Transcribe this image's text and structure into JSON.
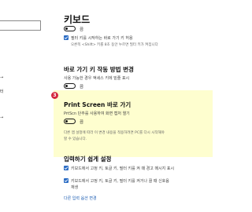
{
  "sidebar": {
    "search_value": "",
    "frag_top": "˄",
    "item_a": "→",
    "item_b": "터",
    "item_c": "→"
  },
  "sticky_keys": {
    "title": "키보드",
    "toggle_state": "끔",
    "checkbox_label": "필터 키를 시작하는 바로 가기 키 허용",
    "description": "오른쪽 <Shift> 키를 8초 동안 누르면 필터 키가 켜집니다"
  },
  "underline_keys": {
    "title": "바로 가기 키 작동 방법 변경",
    "description": "사용 가능한 경우 액세스 키에 밑줄 표시",
    "toggle_state": "끔"
  },
  "print_screen": {
    "badge": "3",
    "title": "Print Screen 바로 가기",
    "description": "PrtScn 단추를 사용하여 화면 캡처 열기",
    "toggle_state": "끔",
    "note_line1": "다른 앱 설정에 따라 이 변경 내용을 적용하려면 PC를 다시 시작해야",
    "note_line2": "할 수 있습니다."
  },
  "typing": {
    "title": "입력하기 쉽게 설정",
    "item1_line1": "키보드에서 고정 키, 토글 키, 필터 키를 켜 때 경고 메시지 표시",
    "item1_line2": "",
    "item2_line1": "키보드에서 고정 키, 토글 키, 필터 키를 켜거나 끌 때 신호음",
    "item2_line2": "재생",
    "link": "다른 입력 옵션 변경"
  },
  "colors": {
    "accent": "#2b6cc4",
    "highlight": "#fefecf",
    "badge": "#d4283e"
  }
}
